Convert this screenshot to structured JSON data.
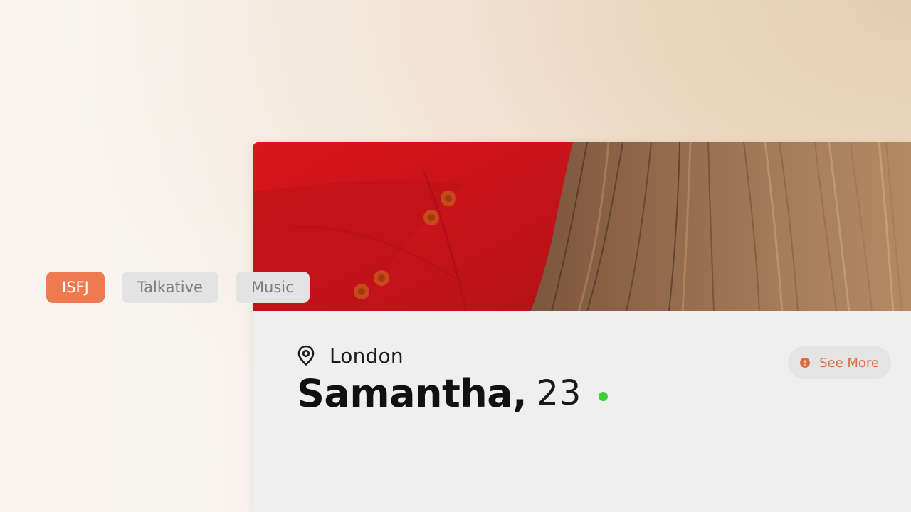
{
  "profile": {
    "location": "London",
    "name": "Samantha,",
    "age": "23",
    "online_status_color": "#3ed03a",
    "see_more_label": "See More",
    "tags": [
      {
        "label": "ISFJ",
        "style": "primary"
      },
      {
        "label": "Talkative",
        "style": "secondary"
      },
      {
        "label": "Music",
        "style": "secondary"
      }
    ]
  },
  "icons": {
    "location": "map-pin-icon",
    "info": "info-icon",
    "online": "online-status-dot"
  },
  "colors": {
    "accent": "#ee7a4f",
    "see_more_text": "#de6b43",
    "name_text": "#111111",
    "card_background": "#efefef",
    "tag_secondary_bg": "#e3e3e3",
    "tag_secondary_text": "#7d7d7d"
  }
}
